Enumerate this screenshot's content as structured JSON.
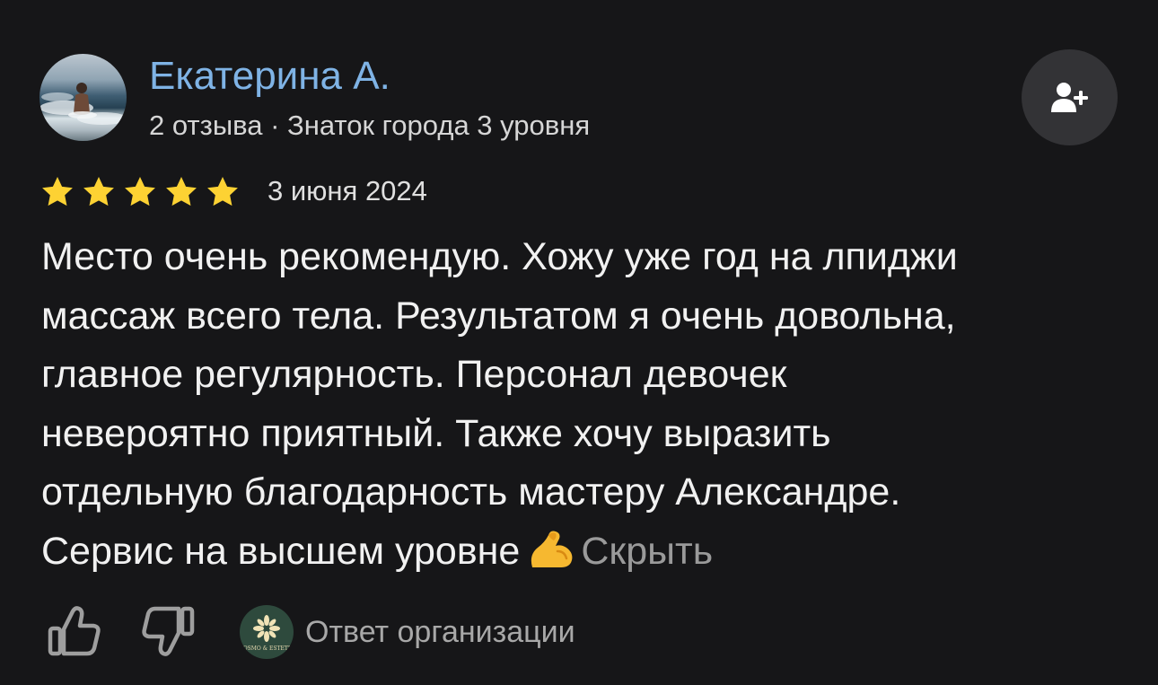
{
  "author": {
    "name": "Екатерина А.",
    "meta": "2 отзыва · Знаток города 3 уровня",
    "avatar_icon": "avatar-photo-sea"
  },
  "subscribe": {
    "icon": "add-user-icon"
  },
  "rating": {
    "stars": 5,
    "max": 5,
    "color": "#fdd233"
  },
  "review": {
    "date": "3 июня 2024",
    "lines": [
      "Место очень рекомендую. Хожу уже год на лпиджи",
      "массаж всего тела. Результатом я очень довольна,",
      "главное регулярность. Персонал девочек",
      "невероятно приятный. Также хочу выразить",
      "отдельную благодарность мастеру Александре.",
      "Сервис на высшем уровне"
    ],
    "emoji": "flexed-biceps",
    "hide_label": "Скрыть"
  },
  "actions": {
    "like_icon": "thumbs-up-icon",
    "dislike_icon": "thumbs-down-icon",
    "org_logo_text": "OSMO & ESTETI",
    "org_reply_label": "Ответ организации"
  },
  "colors": {
    "background": "#161618",
    "author_link": "#7fb3e5",
    "muted": "#9a9a9a",
    "button_bg": "#333336",
    "org_logo_bg": "#2e4a3d"
  }
}
